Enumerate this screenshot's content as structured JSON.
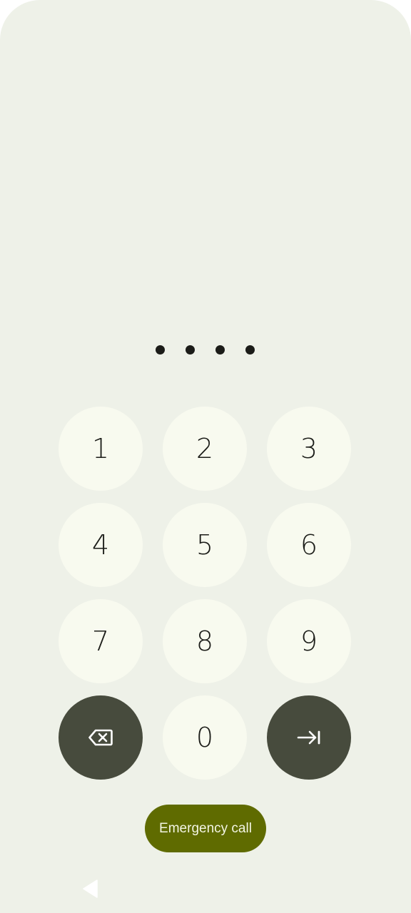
{
  "pin": {
    "entered_digits": 4
  },
  "keypad": {
    "keys": [
      "1",
      "2",
      "3",
      "4",
      "5",
      "6",
      "7",
      "8",
      "9"
    ],
    "zero": "0",
    "backspace_icon": "backspace-icon",
    "enter_icon": "enter-arrow-icon"
  },
  "emergency": {
    "label": "Emergency call"
  },
  "navigation": {
    "back_icon": "back-triangle-icon"
  },
  "colors": {
    "background": "#eef1e8",
    "key_background": "#f8faef",
    "key_dark_background": "#474b3d",
    "emergency_background": "#5f6b00",
    "dot_color": "#1b1c18"
  }
}
